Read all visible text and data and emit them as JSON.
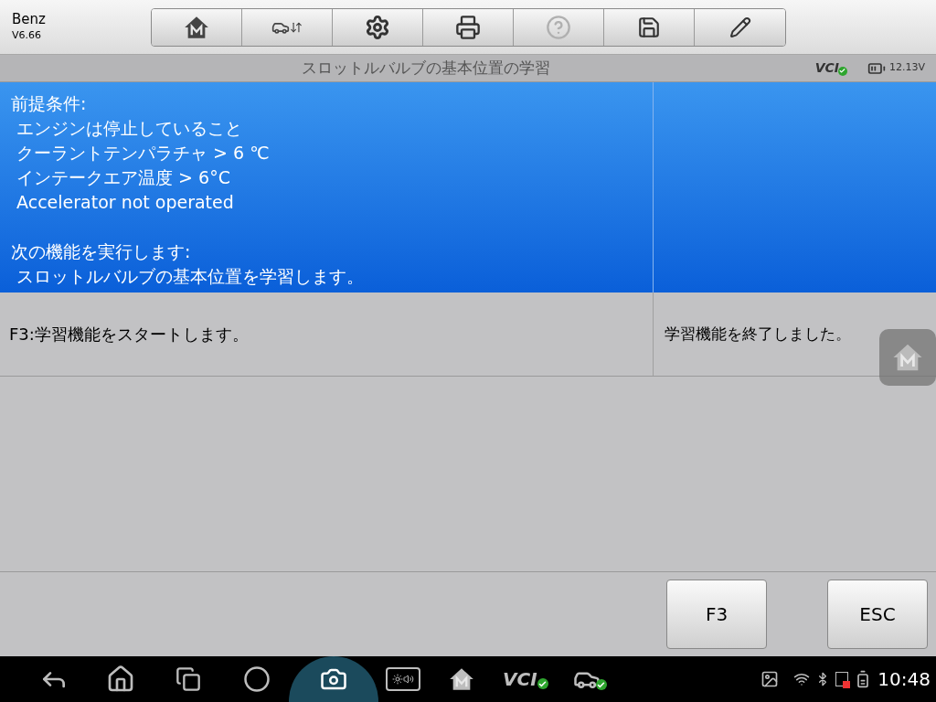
{
  "header": {
    "brand": "Benz",
    "version": "V6.66"
  },
  "title_bar": {
    "title": "スロットルバルブの基本位置の学習",
    "vci_label": "VCI",
    "voltage": "12.13V"
  },
  "info_panel": {
    "paragraphs": [
      [
        "前提条件:",
        " エンジンは停止していること",
        " クーラントテンパラチャ > 6 ℃",
        " インテークエア温度 > 6°C",
        " Accelerator not operated"
      ],
      [
        "次の機能を実行します:",
        " スロットルバルブの基本位置を学習します。"
      ]
    ]
  },
  "message_row": {
    "instruction": "F3:学習機能をスタートします。",
    "status": "学習機能を終了しました。"
  },
  "buttons": [
    "F3",
    "ESC"
  ],
  "nav_bar": {
    "vci_label": "VCI",
    "time": "10:48"
  }
}
